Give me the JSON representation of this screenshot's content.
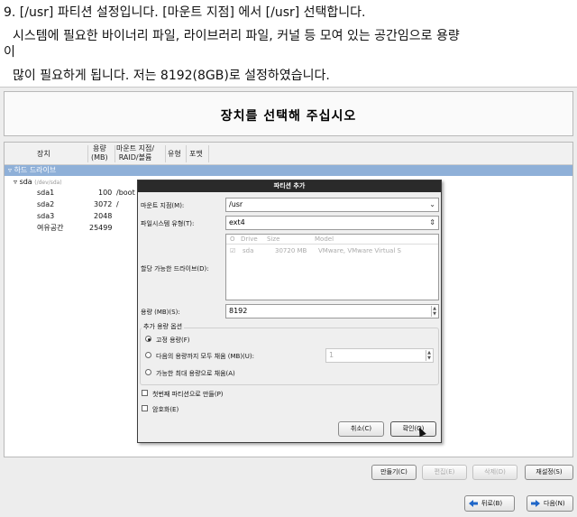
{
  "blog": {
    "line1": "9. [/usr] 파티션 설정입니다. [마운트 지점] 에서 [/usr] 선택합니다.",
    "line2": "시스템에 필요한 바이너리 파일, 라이브러리 파일, 커널 등 모여 있는 공간임으로 용량",
    "line3": "이",
    "line4": "많이 필요하게 됩니다. 저는 8192(8GB)로 설정하였습니다."
  },
  "installer": {
    "header_title": "장치를 선택해 주십시오",
    "columns": {
      "device": "장치",
      "size_l1": "용량",
      "size_l2": "(MB)",
      "mount_l1": "마운트 지점/",
      "mount_l2": "RAID/볼륨",
      "type": "유형",
      "format": "포맷"
    },
    "group_label": "하드 드라이브",
    "disk": {
      "name": "sda",
      "path": "(/dev/sda)"
    },
    "partitions": [
      {
        "name": "sda1",
        "size": "100",
        "mount": "/boot"
      },
      {
        "name": "sda2",
        "size": "3072",
        "mount": "/"
      },
      {
        "name": "sda3",
        "size": "2048",
        "mount": ""
      },
      {
        "name": "여유공간",
        "size": "25499",
        "mount": ""
      }
    ],
    "bottom_buttons": {
      "create": "만들기(C)",
      "edit": "편집(E)",
      "delete": "삭제(D)",
      "reset": "재설정(S)"
    },
    "nav": {
      "back": "뒤로(B)",
      "next": "다음(N)"
    }
  },
  "dialog": {
    "title": "파티션 추가",
    "mount_label": "마운트 지점(M):",
    "mount_value": "/usr",
    "fstype_label": "파일시스템 유형(T):",
    "fstype_value": "ext4",
    "drives_label": "할당 가능한 드라이브(D):",
    "drive_cols": {
      "radio": "O",
      "drive": "Drive",
      "size": "Size",
      "model": "Model"
    },
    "drive_row": {
      "drive": "sda",
      "size": "30720 MB",
      "model": "VMware, VMware Virtual S"
    },
    "size_label": "용량 (MB)(S):",
    "size_value": "8192",
    "options_legend": "추가 용량 옵션",
    "opt_fixed": "고정 용량(F)",
    "opt_fill_upto": "다음의 용량까지 모두 채움 (MB)(U):",
    "opt_fill_upto_value": "1",
    "opt_fill_max": "가능한 최대 용량으로 채움(A)",
    "primary_check": "첫번째 파티션으로 만들(P)",
    "encrypt_check": "암호화(E)",
    "cancel": "취소(C)",
    "ok": "확인(O)"
  },
  "colors": {
    "selection": "#8fb0d8",
    "titlebar": "#2a2a2a",
    "nav_arrow": "#1f66c8"
  }
}
